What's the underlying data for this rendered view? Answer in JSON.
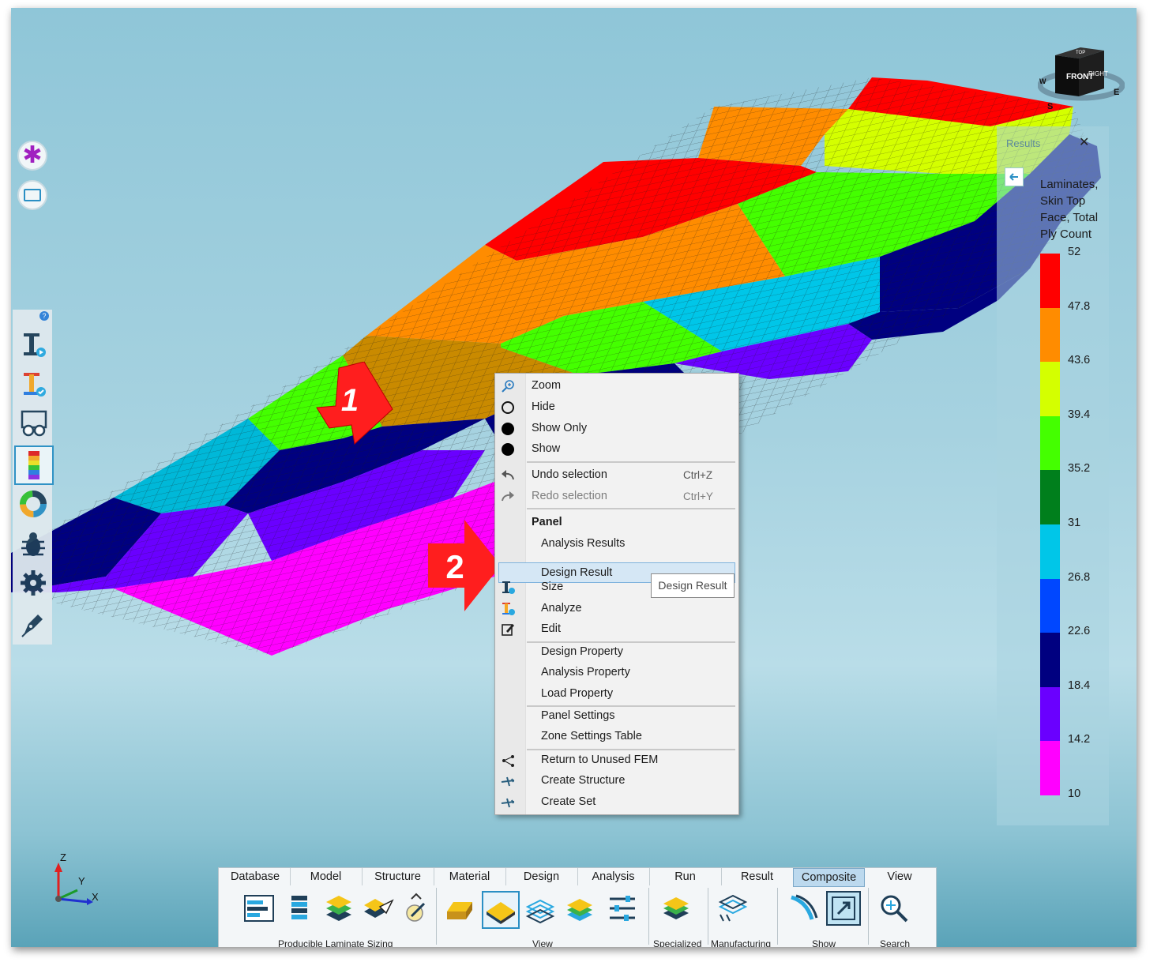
{
  "legend": {
    "title": "Laminates, Skin Top Face, Total Ply Count",
    "panel_title": "Results",
    "close_symbol": "✕",
    "levels": [
      "52",
      "47.8",
      "43.6",
      "39.4",
      "35.2",
      "31",
      "26.8",
      "22.6",
      "18.4",
      "14.2",
      "10"
    ],
    "colors": [
      "#ff0000",
      "#ff8c00",
      "#d4ff00",
      "#44ff00",
      "#007f1c",
      "#00c6e8",
      "#0047ff",
      "#000080",
      "#6a00ff",
      "#ff00ff"
    ]
  },
  "viewcube": {
    "front": "FRONT",
    "right": "RIGHT",
    "top": "TOP",
    "compass_s": "S",
    "compass_e": "E",
    "compass_w": "W"
  },
  "callouts": {
    "one": "1",
    "two": "2"
  },
  "context_menu": {
    "items": [
      {
        "label": "Zoom",
        "icon": "zoom-icon"
      },
      {
        "label": "Hide",
        "icon": "hide-circle-icon"
      },
      {
        "label": "Show Only",
        "icon": "show-only-dot-icon"
      },
      {
        "label": "Show",
        "icon": "show-dot-icon"
      }
    ],
    "undo": {
      "label": "Undo selection",
      "shortcut": "Ctrl+Z"
    },
    "redo": {
      "label": "Redo selection",
      "shortcut": "Ctrl+Y"
    },
    "section": "Panel",
    "panel_items": [
      "Analysis Results",
      "Design Result",
      "Size",
      "Analyze",
      "Edit"
    ],
    "property_items": [
      "Design Property",
      "Analysis Property",
      "Load Property"
    ],
    "settings_items": [
      "Panel Settings",
      "Zone Settings Table"
    ],
    "fem_items": [
      "Return to Unused FEM",
      "Create Structure",
      "Create Set"
    ]
  },
  "tooltip": "Design Result",
  "axes": {
    "z": "Z",
    "y": "Y",
    "x": "X"
  },
  "ribbon": {
    "tabs": [
      "Database",
      "Model",
      "Structure",
      "Material",
      "Design",
      "Analysis",
      "Run",
      "Result",
      "Composite",
      "View"
    ],
    "active_tab": "Composite",
    "groups": [
      "Producible Laminate Sizing",
      "View",
      "Specialized",
      "Manufacturing",
      "Show",
      "Search"
    ]
  }
}
